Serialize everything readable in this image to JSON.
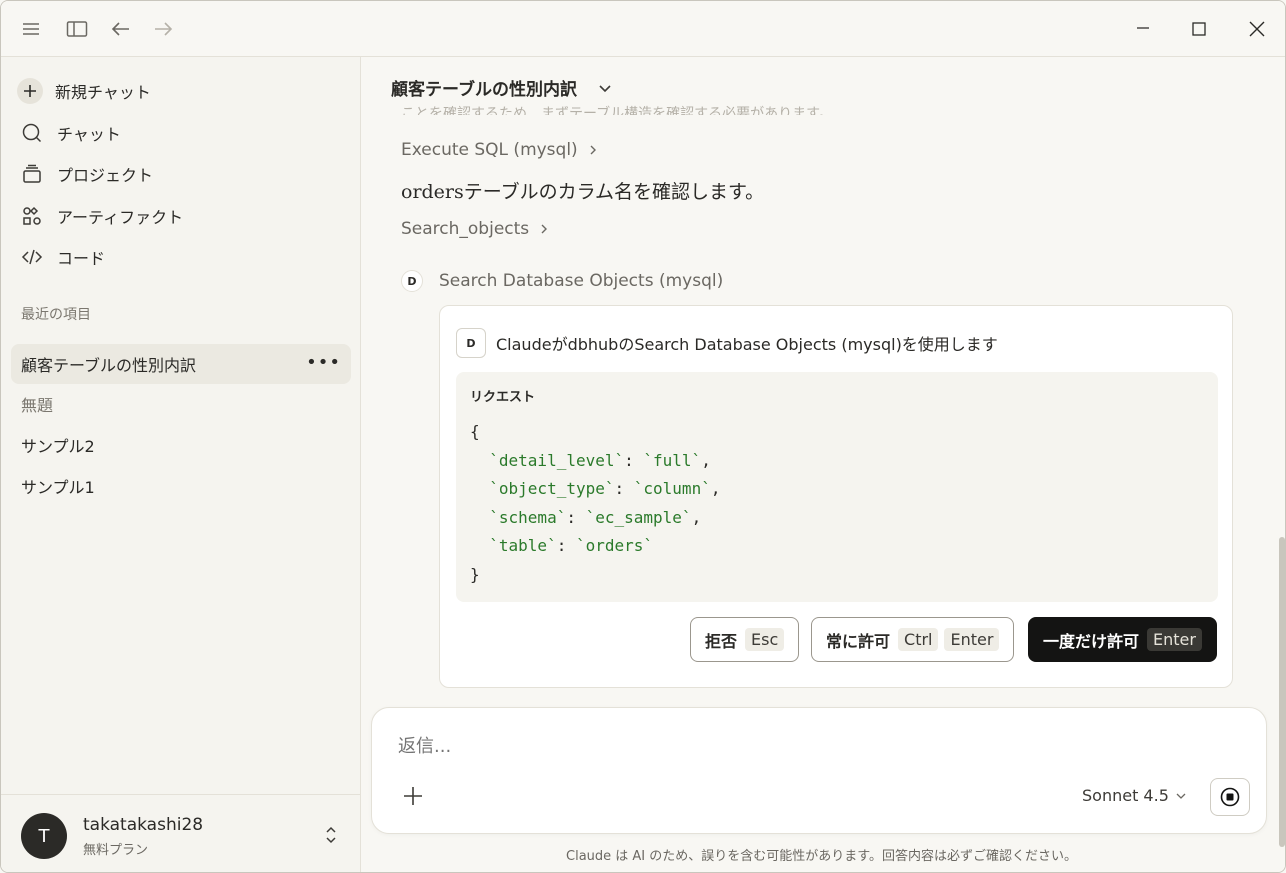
{
  "titlebar": {
    "menu_icon": "hamburger-icon",
    "sidebar_icon": "sidebar-toggle-icon",
    "back_icon": "arrow-left-icon",
    "forward_icon": "arrow-right-icon"
  },
  "sidebar": {
    "nav": [
      {
        "label": "新規チャット",
        "icon": "plus-icon"
      },
      {
        "label": "チャット",
        "icon": "chat-bubble-icon"
      },
      {
        "label": "プロジェクト",
        "icon": "folder-stack-icon"
      },
      {
        "label": "アーティファクト",
        "icon": "artifacts-icon"
      },
      {
        "label": "コード",
        "icon": "code-icon"
      }
    ],
    "recent_label": "最近の項目",
    "recent": [
      {
        "label": "顧客テーブルの性別内訳",
        "active": true
      },
      {
        "label": "無題",
        "active": false
      },
      {
        "label": "サンプル2",
        "active": false
      },
      {
        "label": "サンプル1",
        "active": false
      }
    ],
    "more": "•••",
    "user": {
      "initial": "T",
      "name": "takatakashi28",
      "plan": "無料プラン"
    }
  },
  "main": {
    "title": "顧客テーブルの性別内訳",
    "faded_line": "ことを確認するため、まずテーブル構造を確認する必要があります。",
    "tool_execute": "Execute SQL (mysql)",
    "answer": "ordersテーブルのカラム名を確認します。",
    "tool_search": "Search_objects",
    "tool_row_badge": "D",
    "tool_row_label": "Search Database Objects (mysql)",
    "permission": {
      "badge": "D",
      "heading": "ClaudeがdbhubのSearch Database Objects (mysql)を使用します",
      "request_label": "リクエスト",
      "code": {
        "open": "{",
        "close": "}",
        "lines": [
          {
            "key": "`detail_level`",
            "value": "`full`",
            "comma": ","
          },
          {
            "key": "`object_type`",
            "value": "`column`",
            "comma": ","
          },
          {
            "key": "`schema`",
            "value": "`ec_sample`",
            "comma": ","
          },
          {
            "key": "`table`",
            "value": "`orders`",
            "comma": ""
          }
        ]
      },
      "buttons": {
        "deny": {
          "label": "拒否",
          "kbd1": "Esc"
        },
        "always": {
          "label": "常に許可",
          "kbd1": "Ctrl",
          "kbd2": "Enter"
        },
        "once": {
          "label": "一度だけ許可",
          "kbd1": "Enter"
        }
      }
    },
    "composer": {
      "placeholder": "返信...",
      "model": "Sonnet 4.5"
    },
    "disclaimer": "Claude は AI のため、誤りを含む可能性があります。回答内容は必ずご確認ください。"
  }
}
